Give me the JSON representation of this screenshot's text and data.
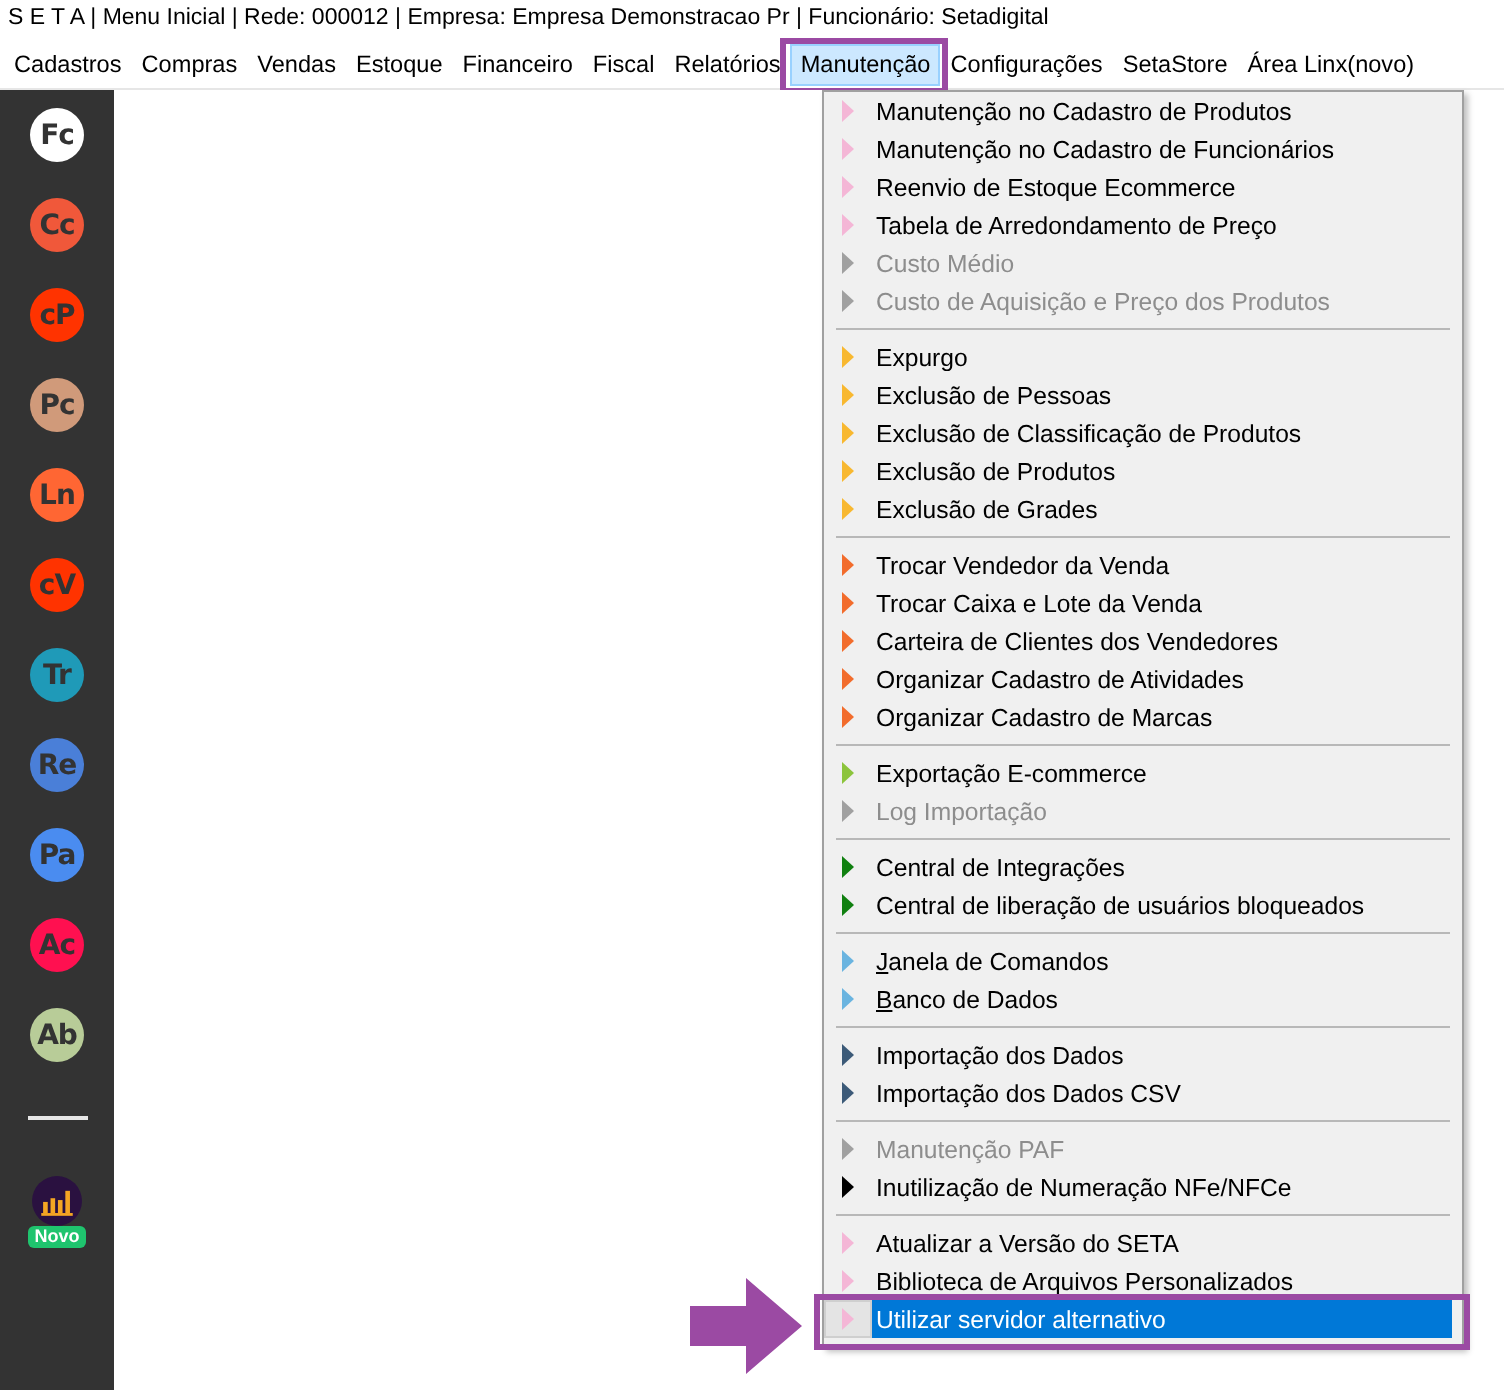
{
  "window": {
    "title": "S E T A | Menu Inicial | Rede: 000012 | Empresa: Empresa Demonstracao Pr | Funcionário: Setadigital"
  },
  "menubar": [
    {
      "label": "Cadastros",
      "selected": false
    },
    {
      "label": "Compras",
      "selected": false
    },
    {
      "label": "Vendas",
      "selected": false
    },
    {
      "label": "Estoque",
      "selected": false
    },
    {
      "label": "Financeiro",
      "selected": false
    },
    {
      "label": "Fiscal",
      "selected": false
    },
    {
      "label": "Relatórios",
      "selected": false
    },
    {
      "label": "Manutenção",
      "selected": true
    },
    {
      "label": "Configurações",
      "selected": false
    },
    {
      "label": "SetaStore",
      "selected": false
    },
    {
      "label": "Área Linx(novo)",
      "selected": false
    }
  ],
  "sidebar": {
    "items": [
      {
        "label": "Fc",
        "color": "#ffffff"
      },
      {
        "label": "Cc",
        "color": "#f0583a"
      },
      {
        "label": "cP",
        "color": "#ff3300"
      },
      {
        "label": "Pc",
        "color": "#d09a7a"
      },
      {
        "label": "Ln",
        "color": "#ff6633"
      },
      {
        "label": "cV",
        "color": "#ff3300"
      },
      {
        "label": "Tr",
        "color": "#1f9ab8"
      },
      {
        "label": "Re",
        "color": "#4a7fd8"
      },
      {
        "label": "Pa",
        "color": "#4a8cf0"
      },
      {
        "label": "Ac",
        "color": "#ff1050"
      },
      {
        "label": "Ab",
        "color": "#b8cc98"
      }
    ],
    "featured": {
      "badge": "Novo"
    }
  },
  "dropdown": {
    "groups": [
      {
        "items": [
          {
            "label": "Manutenção no Cadastro de Produtos",
            "color": "#f4b6d6",
            "disabled": false,
            "selected": false,
            "underline_first": false
          },
          {
            "label": "Manutenção no Cadastro de Funcionários",
            "color": "#f4b6d6",
            "disabled": false,
            "selected": false,
            "underline_first": false
          },
          {
            "label": "Reenvio de Estoque Ecommerce",
            "color": "#f4b6d6",
            "disabled": false,
            "selected": false,
            "underline_first": false
          },
          {
            "label": "Tabela de Arredondamento de Preço",
            "color": "#f4b6d6",
            "disabled": false,
            "selected": false,
            "underline_first": false
          },
          {
            "label": "Custo Médio",
            "color": "#a0a0a0",
            "disabled": true,
            "selected": false,
            "underline_first": false
          },
          {
            "label": "Custo de Aquisição e Preço dos Produtos",
            "color": "#a0a0a0",
            "disabled": true,
            "selected": false,
            "underline_first": false
          }
        ]
      },
      {
        "items": [
          {
            "label": "Expurgo",
            "color": "#f8b830",
            "disabled": false,
            "selected": false,
            "underline_first": false
          },
          {
            "label": "Exclusão de Pessoas",
            "color": "#f8b830",
            "disabled": false,
            "selected": false,
            "underline_first": false
          },
          {
            "label": "Exclusão de Classificação de Produtos",
            "color": "#f8b830",
            "disabled": false,
            "selected": false,
            "underline_first": false
          },
          {
            "label": "Exclusão de Produtos",
            "color": "#f8b830",
            "disabled": false,
            "selected": false,
            "underline_first": false
          },
          {
            "label": "Exclusão de Grades",
            "color": "#f8b830",
            "disabled": false,
            "selected": false,
            "underline_first": false
          }
        ]
      },
      {
        "items": [
          {
            "label": "Trocar Vendedor da Venda",
            "color": "#f26c2c",
            "disabled": false,
            "selected": false,
            "underline_first": false
          },
          {
            "label": "Trocar Caixa e Lote da Venda",
            "color": "#f26c2c",
            "disabled": false,
            "selected": false,
            "underline_first": false
          },
          {
            "label": "Carteira de Clientes dos Vendedores",
            "color": "#f26c2c",
            "disabled": false,
            "selected": false,
            "underline_first": false
          },
          {
            "label": "Organizar Cadastro de Atividades",
            "color": "#f26c2c",
            "disabled": false,
            "selected": false,
            "underline_first": false
          },
          {
            "label": "Organizar Cadastro de Marcas",
            "color": "#f26c2c",
            "disabled": false,
            "selected": false,
            "underline_first": false
          }
        ]
      },
      {
        "items": [
          {
            "label": "Exportação E-commerce",
            "color": "#8cc43c",
            "disabled": false,
            "selected": false,
            "underline_first": false
          },
          {
            "label": "Log Importação",
            "color": "#a0a0a0",
            "disabled": true,
            "selected": false,
            "underline_first": false
          }
        ]
      },
      {
        "items": [
          {
            "label": "Central de Integrações",
            "color": "#108010",
            "disabled": false,
            "selected": false,
            "underline_first": false
          },
          {
            "label": "Central de liberação de usuários bloqueados",
            "color": "#108010",
            "disabled": false,
            "selected": false,
            "underline_first": false
          }
        ]
      },
      {
        "items": [
          {
            "label": "Janela de Comandos",
            "color": "#6ab4e0",
            "disabled": false,
            "selected": false,
            "underline_first": true
          },
          {
            "label": "Banco de Dados",
            "color": "#6ab4e0",
            "disabled": false,
            "selected": false,
            "underline_first": true
          }
        ]
      },
      {
        "items": [
          {
            "label": "Importação dos Dados",
            "color": "#3c5a78",
            "disabled": false,
            "selected": false,
            "underline_first": false
          },
          {
            "label": "Importação dos Dados CSV",
            "color": "#3c5a78",
            "disabled": false,
            "selected": false,
            "underline_first": false
          }
        ]
      },
      {
        "items": [
          {
            "label": "Manutenção PAF",
            "color": "#a0a0a0",
            "disabled": true,
            "selected": false,
            "underline_first": false
          },
          {
            "label": "Inutilização de Numeração NFe/NFCe",
            "color": "#000000",
            "disabled": false,
            "selected": false,
            "underline_first": false
          }
        ]
      },
      {
        "items": [
          {
            "label": "Atualizar a Versão do SETA",
            "color": "#f4b6d6",
            "disabled": false,
            "selected": false,
            "underline_first": false
          },
          {
            "label": "Biblioteca de Arquivos Personalizados",
            "color": "#f4b6d6",
            "disabled": false,
            "selected": false,
            "underline_first": false
          },
          {
            "label": "Utilizar servidor alternativo",
            "color": "#f4b6d6",
            "disabled": false,
            "selected": true,
            "underline_first": false
          }
        ]
      }
    ]
  }
}
